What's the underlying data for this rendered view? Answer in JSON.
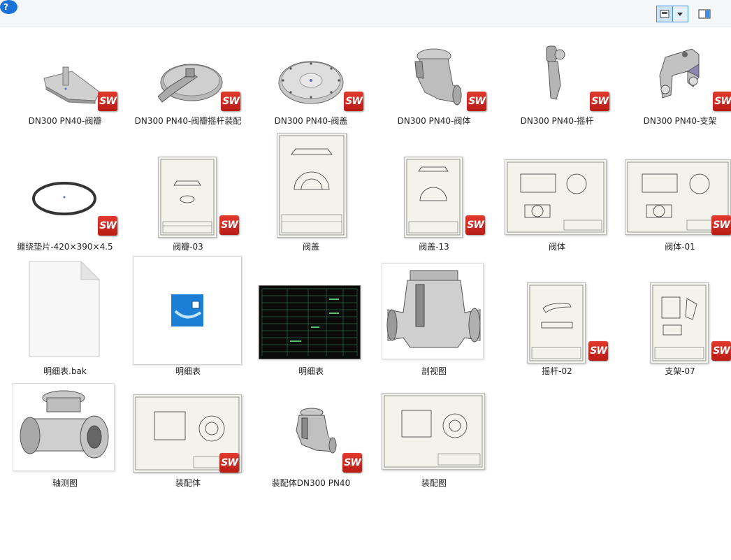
{
  "toolbar": {
    "view_icon": "details-view-icon",
    "dropdown_icon": "chevron-down-icon",
    "pane_icon": "preview-pane-icon",
    "help_label": "?"
  },
  "files": [
    {
      "name": "DN300 PN40-阀瓣",
      "type": "part",
      "badge": "SW"
    },
    {
      "name": "DN300 PN40-阀瓣摇杆装配",
      "type": "assembly",
      "badge": "SW"
    },
    {
      "name": "DN300 PN40-阀盖",
      "type": "part",
      "badge": "SW"
    },
    {
      "name": "DN300 PN40-阀体",
      "type": "part",
      "badge": "SW"
    },
    {
      "name": "DN300 PN40-摇杆",
      "type": "part",
      "badge": "SW"
    },
    {
      "name": "DN300 PN40-支架",
      "type": "part",
      "badge": "SW"
    },
    {
      "name": "缠绕垫片-420×390×4.5",
      "type": "part",
      "badge": "SW"
    },
    {
      "name": "阀瓣-03",
      "type": "drawing",
      "badge": "SW"
    },
    {
      "name": "阀盖",
      "type": "image"
    },
    {
      "name": "阀盖-13",
      "type": "drawing",
      "badge": "SW"
    },
    {
      "name": "阀体",
      "type": "image"
    },
    {
      "name": "阀体-01",
      "type": "drawing",
      "badge": "SW"
    },
    {
      "name": "明细表.bak",
      "type": "generic"
    },
    {
      "name": "明细表",
      "type": "cad"
    },
    {
      "name": "明细表",
      "type": "table"
    },
    {
      "name": "剖视图",
      "type": "render"
    },
    {
      "name": "摇杆-02",
      "type": "drawing",
      "badge": "SW"
    },
    {
      "name": "支架-07",
      "type": "drawing",
      "badge": "SW"
    },
    {
      "name": "轴测图",
      "type": "render"
    },
    {
      "name": "装配体",
      "type": "drawing",
      "badge": "SW"
    },
    {
      "name": "装配体DN300 PN40",
      "type": "assembly",
      "badge": "SW"
    },
    {
      "name": "装配图",
      "type": "image"
    }
  ]
}
